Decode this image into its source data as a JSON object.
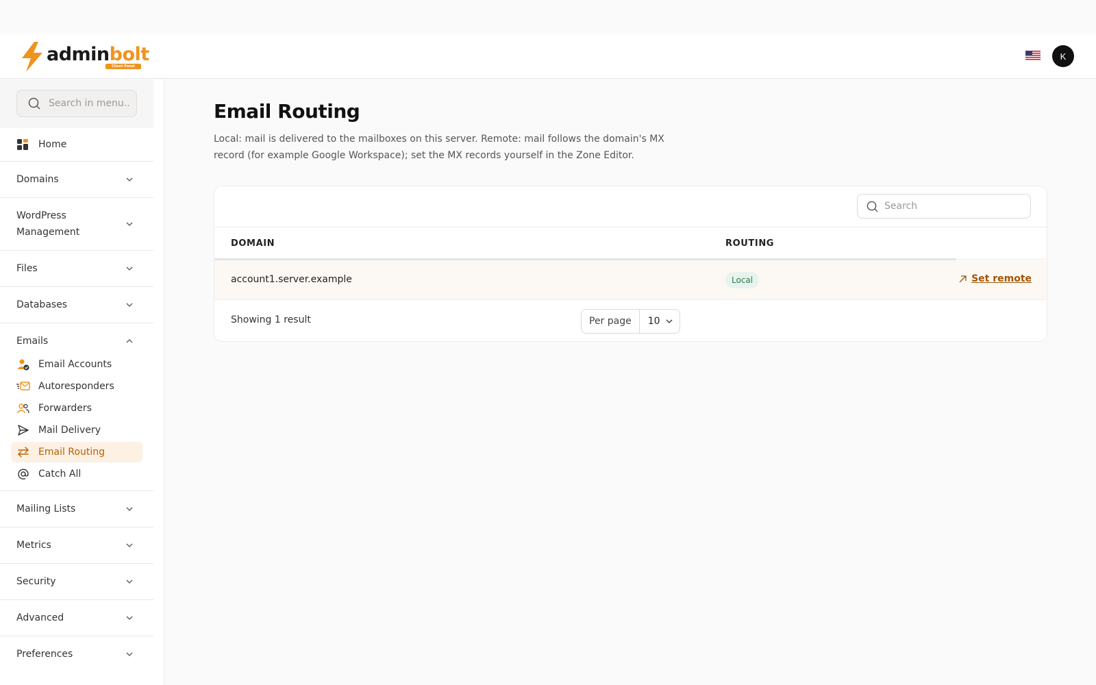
{
  "brand": {
    "name_part1": "admin",
    "name_part2": "bolt",
    "badge": "Client Panel",
    "accent": "#f0931e"
  },
  "header": {
    "avatar_letter": "K",
    "language": "us-flag"
  },
  "sidebar": {
    "search_placeholder": "Search in menu..",
    "home": "Home",
    "groups": [
      {
        "label": "Domains"
      },
      {
        "label": "WordPress Management"
      },
      {
        "label": "Files"
      },
      {
        "label": "Databases"
      },
      {
        "label": "Emails"
      },
      {
        "label": "Mailing Lists"
      },
      {
        "label": "Metrics"
      },
      {
        "label": "Security"
      },
      {
        "label": "Advanced"
      },
      {
        "label": "Preferences"
      }
    ],
    "email_items": [
      {
        "label": "Email Accounts",
        "icon": "user-check-icon"
      },
      {
        "label": "Autoresponders",
        "icon": "fast-mail-icon"
      },
      {
        "label": "Forwarders",
        "icon": "users-icon"
      },
      {
        "label": "Mail Delivery",
        "icon": "send-icon"
      },
      {
        "label": "Email Routing",
        "icon": "arrows-exchange-icon",
        "active": true
      },
      {
        "label": "Catch All",
        "icon": "at-icon"
      }
    ]
  },
  "main": {
    "title": "Email Routing",
    "description": "Local: mail is delivered to the mailboxes on this server. Remote: mail follows the domain's MX record (for example Google Workspace); set the MX records yourself in the Zone Editor.",
    "search_placeholder": "Search",
    "columns": {
      "domain": "DOMAIN",
      "routing": "ROUTING"
    },
    "rows": [
      {
        "domain": "account1.server.example",
        "routing": "Local",
        "action": "Set remote"
      }
    ],
    "footer": {
      "showing": "Showing 1 result",
      "per_page_label": "Per page",
      "per_page_value": "10"
    }
  }
}
